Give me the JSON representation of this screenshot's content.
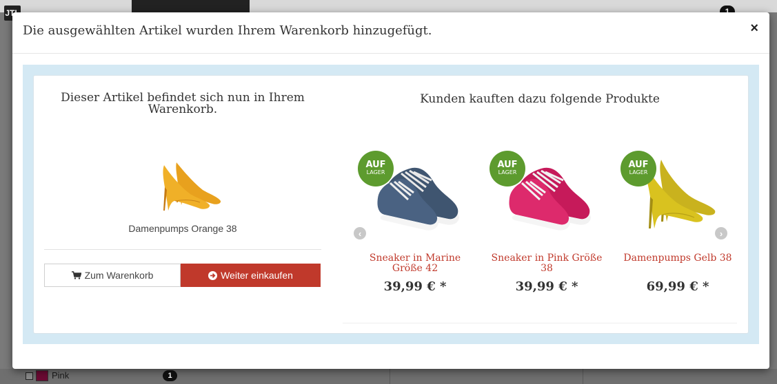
{
  "background": {
    "logo_text": "JTL",
    "cart_badge": "1",
    "filter_item_label": "Pink",
    "filter_item_count": "1"
  },
  "modal": {
    "title": "Die ausgewählten Artikel wurden Ihrem Warenkorb hinzugefügt.",
    "close_label": "×"
  },
  "added_item": {
    "heading": "Dieser Artikel befindet sich nun in Ihrem Warenkorb.",
    "product_name": "Damenpumps Orange 38",
    "cart_button_label": "Zum Warenkorb",
    "continue_button_label": "Weiter einkaufen"
  },
  "cross_selling": {
    "heading": "Kunden kauften dazu folgende Produkte",
    "products": [
      {
        "name": "Sneaker in Marine Größe 42",
        "price": "39,99 € *",
        "badge_line1": "AUF",
        "badge_line2": "LAGER"
      },
      {
        "name": "Sneaker in Pink Größe 38",
        "price": "39,99 € *",
        "badge_line1": "AUF",
        "badge_line2": "LAGER"
      },
      {
        "name": "Damenpumps Gelb 38",
        "price": "69,99 € *",
        "badge_line1": "AUF",
        "badge_line2": "LAGER"
      }
    ]
  },
  "icons": {
    "cart": "shopping-cart-icon",
    "continue": "arrow-circle-right-icon",
    "prev": "chevron-left-icon",
    "next": "chevron-right-icon"
  },
  "colors": {
    "accent": "#c0392b",
    "stock_badge": "#5d9b2e",
    "panel_bg": "#d4e9f4"
  }
}
